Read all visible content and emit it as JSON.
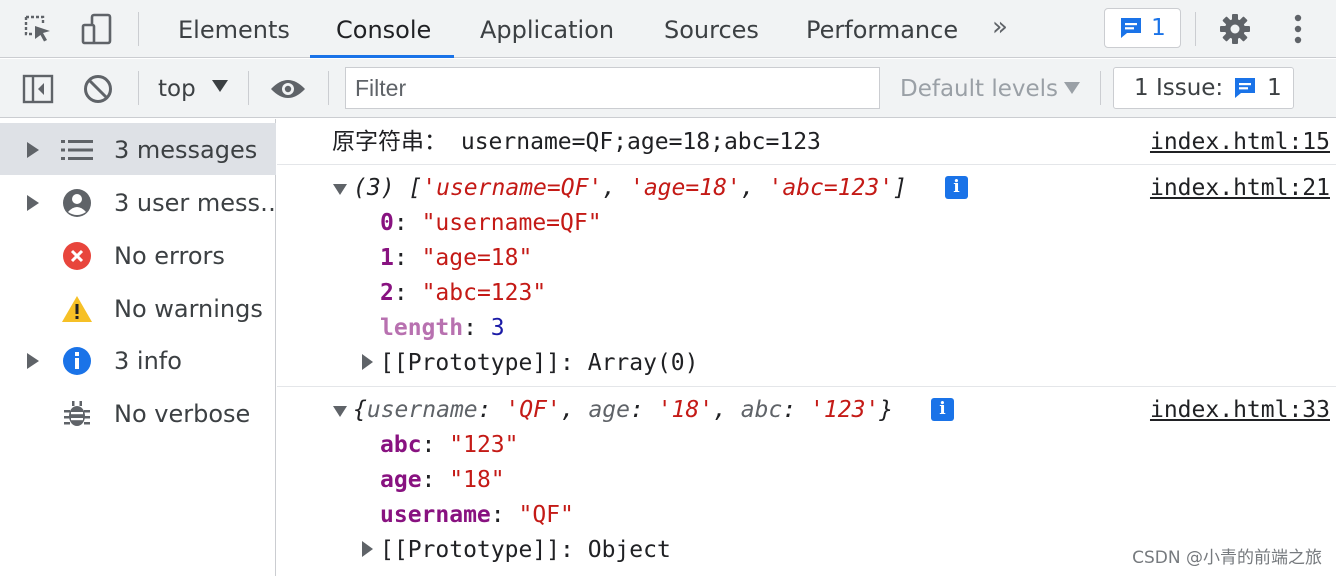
{
  "tabs": {
    "elements": "Elements",
    "console": "Console",
    "application": "Application",
    "sources": "Sources",
    "performance": "Performance",
    "more": "»"
  },
  "top_issues_count": "1",
  "toolbar": {
    "context": "top",
    "filter_placeholder": "Filter",
    "levels": "Default levels",
    "issues_label": "1 Issue:",
    "issues_count": "1"
  },
  "sidebar": {
    "items": [
      {
        "label": "3 messages",
        "icon": "list-icon"
      },
      {
        "label": "3 user mess…",
        "icon": "user-icon"
      },
      {
        "label": "No errors",
        "icon": "error-icon"
      },
      {
        "label": "No warnings",
        "icon": "warning-icon"
      },
      {
        "label": "3 info",
        "icon": "info-icon"
      },
      {
        "label": "No verbose",
        "icon": "bug-icon"
      }
    ]
  },
  "messages": [
    {
      "source": "index.html:15",
      "prefix": "原字符串：",
      "text": "username=QF;age=18;abc=123"
    },
    {
      "source": "index.html:21",
      "summary": {
        "count": "(3)",
        "items": [
          "'username=QF'",
          "'age=18'",
          "'abc=123'"
        ]
      },
      "entries": [
        {
          "key": "0",
          "value": "\"username=QF\""
        },
        {
          "key": "1",
          "value": "\"age=18\""
        },
        {
          "key": "2",
          "value": "\"abc=123\""
        },
        {
          "key": "length",
          "value": "3"
        }
      ],
      "proto": "[[Prototype]]",
      "proto_value": "Array(0)"
    },
    {
      "source": "index.html:33",
      "summary": {
        "pairs": [
          {
            "key": "username",
            "value": "'QF'"
          },
          {
            "key": "age",
            "value": "'18'"
          },
          {
            "key": "abc",
            "value": "'123'"
          }
        ]
      },
      "entries": [
        {
          "key": "abc",
          "value": "\"123\""
        },
        {
          "key": "age",
          "value": "\"18\""
        },
        {
          "key": "username",
          "value": "\"QF\""
        }
      ],
      "proto": "[[Prototype]]",
      "proto_value": "Object"
    }
  ],
  "watermark": "CSDN @小青的前端之旅",
  "colors": {
    "accent": "#1a73e8",
    "error": "#d93025",
    "warning": "#f2c200",
    "key": "#881280",
    "string": "#c41a16",
    "number": "#1a1aa6"
  }
}
